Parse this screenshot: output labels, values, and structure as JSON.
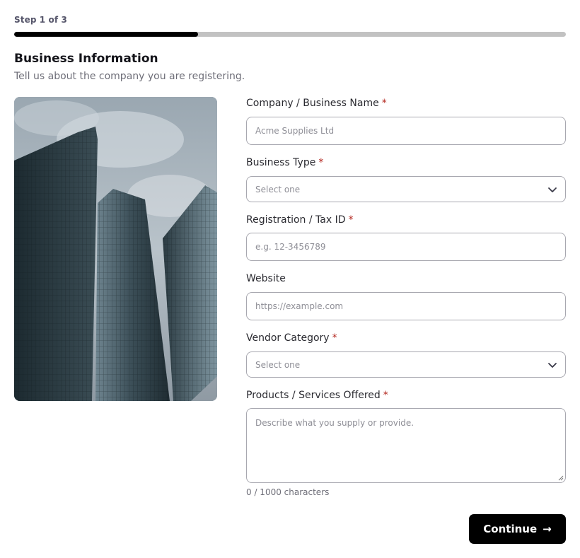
{
  "progress": {
    "step_label": "Step 1 of 3",
    "fraction_complete": 0.333
  },
  "section": {
    "title": "Business Information",
    "subtitle": "Tell us about the company you are registering."
  },
  "form": {
    "company_name": {
      "label": "Company / Business Name",
      "required_mark": "*",
      "placeholder": "Acme Supplies Ltd"
    },
    "business_type": {
      "label": "Business Type",
      "required_mark": "*",
      "selected": "Select one"
    },
    "tax_id": {
      "label": "Registration / Tax ID",
      "required_mark": "*",
      "placeholder": "e.g. 12-3456789"
    },
    "website": {
      "label": "Website",
      "placeholder": "https://example.com"
    },
    "vendor_category": {
      "label": "Vendor Category",
      "required_mark": "*",
      "selected": "Select one"
    },
    "products": {
      "label": "Products / Services Offered",
      "required_mark": "*",
      "placeholder": "Describe what you supply or provide.",
      "counter": "0 / 1000 characters"
    }
  },
  "actions": {
    "continue_label": "Continue",
    "continue_icon": "→"
  },
  "icons": {
    "select_chevron": "chevron-down-icon",
    "resize_handle": "resize-grip-icon"
  },
  "colors": {
    "accent": "#000000",
    "track": "#c2c2c2",
    "required": "#b3261e",
    "border": "#a8a8b0"
  }
}
